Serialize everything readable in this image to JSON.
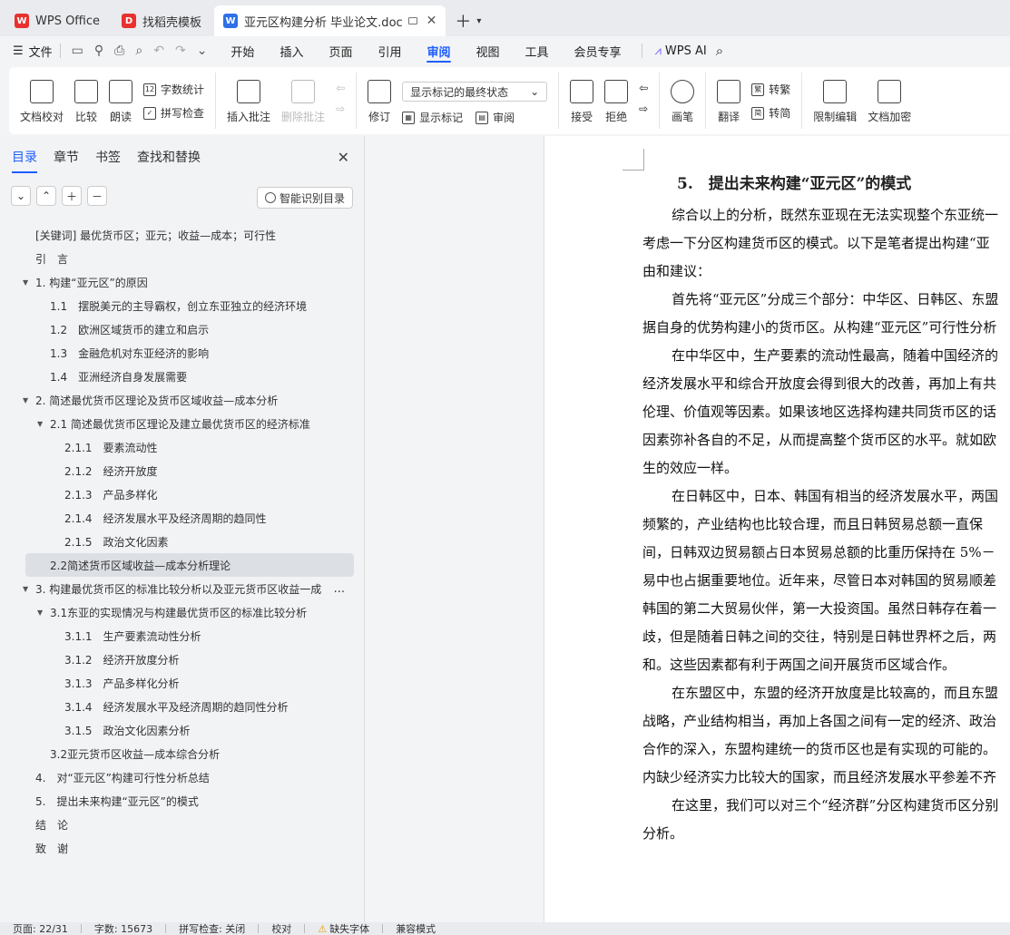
{
  "tabs": [
    {
      "label": "WPS Office",
      "color": "#e8312f",
      "glyph": "W"
    },
    {
      "label": "找稻壳模板",
      "color": "#e8312f",
      "glyph": "D"
    },
    {
      "label": "亚元区构建分析 毕业论文.doc",
      "color": "#2f6fe8",
      "glyph": "W",
      "active": true
    }
  ],
  "menubar": {
    "file": "文件",
    "items": [
      "开始",
      "插入",
      "页面",
      "引用",
      "审阅",
      "视图",
      "工具",
      "会员专享"
    ],
    "active": "审阅",
    "wps_ai": "WPS AI"
  },
  "ribbon": {
    "proof": "文档校对",
    "compare": "比较",
    "read_aloud": "朗读",
    "word_count": "字数统计",
    "spell_check": "拼写检查",
    "insert_comment": "插入批注",
    "delete_comment": "删除批注",
    "revise": "修订",
    "markup_select": "显示标记的最终状态",
    "show_markup": "显示标记",
    "review": "审阅",
    "accept": "接受",
    "reject": "拒绝",
    "pen": "画笔",
    "translate": "翻译",
    "to_traditional": "转繁",
    "to_simplified": "转简",
    "restrict_edit": "限制编辑",
    "doc_encrypt": "文档加密"
  },
  "sidebar": {
    "tabs": [
      "目录",
      "章节",
      "书签",
      "查找和替换"
    ],
    "active_tab": "目录",
    "smart_toc": "智能识别目录",
    "toc": [
      {
        "text": "[关键词] 最优货币区；亚元；收益—成本；可行性",
        "level": 0
      },
      {
        "text": "引　言",
        "level": 0
      },
      {
        "text": "1. 构建“亚元区”的原因",
        "level": 0,
        "expanded": true
      },
      {
        "text": "1.1　摆脱美元的主导霸权，创立东亚独立的经济环境",
        "level": 1
      },
      {
        "text": "1.2　欧洲区域货币的建立和启示",
        "level": 1
      },
      {
        "text": "1.3　金融危机对东亚经济的影响",
        "level": 1
      },
      {
        "text": "1.4　亚洲经济自身发展需要",
        "level": 1
      },
      {
        "text": "2. 简述最优货币区理论及货币区域收益—成本分析",
        "level": 0,
        "expanded": true
      },
      {
        "text": "2.1 简述最优货币区理论及建立最优货币区的经济标准",
        "level": 1,
        "expanded": true
      },
      {
        "text": "2.1.1　要素流动性",
        "level": 2
      },
      {
        "text": "2.1.2　经济开放度",
        "level": 2
      },
      {
        "text": "2.1.3　产品多样化",
        "level": 2
      },
      {
        "text": "2.1.4　经济发展水平及经济周期的趋同性",
        "level": 2
      },
      {
        "text": "2.1.5　政治文化因素",
        "level": 2
      },
      {
        "text": "2.2简述货币区域收益—成本分析理论",
        "level": 1,
        "selected": true
      },
      {
        "text": "3. 构建最优货币区的标准比较分析以及亚元货币区收益一成",
        "level": 0,
        "expanded": true,
        "more": "..."
      },
      {
        "text": "3.1东亚的实现情况与构建最优货币区的标准比较分析",
        "level": 1,
        "expanded": true
      },
      {
        "text": "3.1.1　生产要素流动性分析",
        "level": 2
      },
      {
        "text": "3.1.2　经济开放度分析",
        "level": 2
      },
      {
        "text": "3.1.3　产品多样化分析",
        "level": 2
      },
      {
        "text": "3.1.4　经济发展水平及经济周期的趋同性分析",
        "level": 2
      },
      {
        "text": "3.1.5　政治文化因素分析",
        "level": 2
      },
      {
        "text": "3.2亚元货币区收益—成本综合分析",
        "level": 1
      },
      {
        "text": "4.　对“亚元区”构建可行性分析总结",
        "level": 0
      },
      {
        "text": "5.　提出未来构建“亚元区”的模式",
        "level": 0
      },
      {
        "text": "结　论",
        "level": 0
      },
      {
        "text": "致　谢",
        "level": 0
      }
    ]
  },
  "document": {
    "heading": "5.　提出未来构建“亚元区”的模式",
    "lines": [
      {
        "text": "综合以上的分析，既然东亚现在无法实现整个东亚统一",
        "indent": true
      },
      {
        "text": "考虑一下分区构建货币区的模式。以下是笔者提出构建“亚",
        "indent": false
      },
      {
        "text": "由和建议：",
        "indent": false
      },
      {
        "text": "首先将“亚元区”分成三个部分：中华区、日韩区、东盟",
        "indent": true
      },
      {
        "text": "据自身的优势构建小的货币区。从构建“亚元区”可行性分析",
        "indent": false
      },
      {
        "text": "在中华区中，生产要素的流动性最高，随着中国经济的",
        "indent": true
      },
      {
        "text": "经济发展水平和综合开放度会得到很大的改善，再加上有共",
        "indent": false
      },
      {
        "text": "伦理、价值观等因素。如果该地区选择构建共同货币区的话",
        "indent": false
      },
      {
        "text": "因素弥补各自的不足，从而提高整个货币区的水平。就如欧",
        "indent": false
      },
      {
        "text": "生的效应一样。",
        "indent": false
      },
      {
        "text": "在日韩区中，日本、韩国有相当的经济发展水平，两国",
        "indent": true
      },
      {
        "text": "频繁的，产业结构也比较合理，而且日韩贸易总额一直保",
        "indent": false
      },
      {
        "text": "间，日韩双边贸易额占日本贸易总额的比重历保持在 5%－",
        "indent": false
      },
      {
        "text": "易中也占据重要地位。近年来，尽管日本对韩国的贸易顺差",
        "indent": false
      },
      {
        "text": "韩国的第二大贸易伙伴，第一大投资国。虽然日韩存在着一",
        "indent": false
      },
      {
        "text": "歧，但是随着日韩之间的交往，特别是日韩世界杯之后，两",
        "indent": false
      },
      {
        "text": "和。这些因素都有利于两国之间开展货币区域合作。",
        "indent": false
      },
      {
        "text": "在东盟区中，东盟的经济开放度是比较高的，而且东盟",
        "indent": true
      },
      {
        "text": "战略，产业结构相当，再加上各国之间有一定的经济、政治",
        "indent": false
      },
      {
        "text": "合作的深入，东盟构建统一的货币区也是有实现的可能的。",
        "indent": false
      },
      {
        "text": "内缺少经济实力比较大的国家，而且经济发展水平参差不齐",
        "indent": false
      },
      {
        "text": "在这里，我们可以对三个“经济群”分区构建货币区分别",
        "indent": true
      },
      {
        "text": "分析。",
        "indent": false
      }
    ]
  },
  "statusbar": {
    "page": "页面: 22/31",
    "words": "字数: 15673",
    "spell": "拼写检查: 关闭",
    "proof": "校对",
    "missing_font": "缺失字体",
    "compat": "兼容模式"
  },
  "colors": {
    "accent": "#1e5eff",
    "wps_red": "#e8312f",
    "word_blue": "#2f6fe8"
  }
}
